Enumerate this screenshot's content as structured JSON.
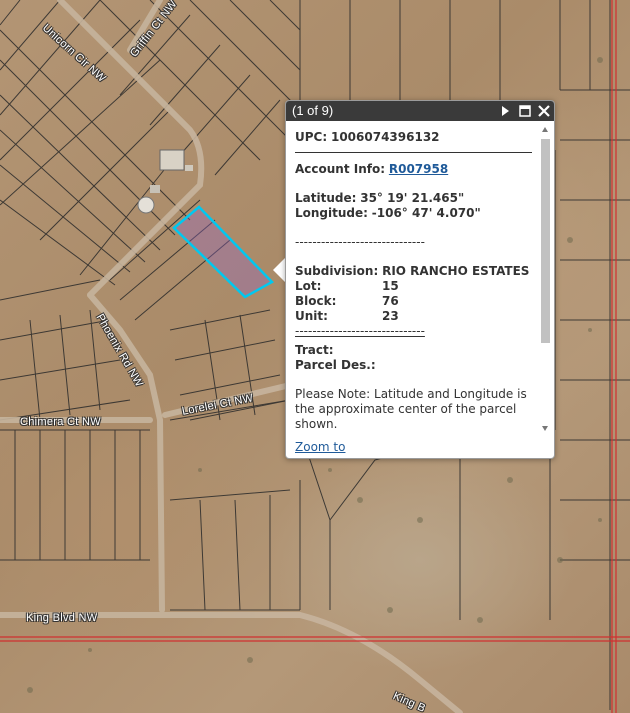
{
  "map": {
    "streets": {
      "unicorn": "Unicorn Cir NW",
      "griffin": "Griffin Ct NW",
      "phoenix": "Phoenix Rd NW",
      "lorelei": "Lorelei Ct NW",
      "chimera": "Chimera Ct NW",
      "king": "King Blvd NW",
      "king_cut": "King B"
    },
    "parcel_highlight_color": "#00c8f0",
    "boundary_line_color": "#d03030",
    "lot_line_color": "#2a2a2a"
  },
  "popup": {
    "title": "(1 of 9)",
    "upc_label": "UPC:",
    "upc_value": "1006074396132",
    "account_label": "Account Info:",
    "account_value": "R007958",
    "latitude_label": "Latitude:",
    "latitude_value": "35° 19' 21.465\"",
    "longitude_label": "Longitude:",
    "longitude_value": "-106° 47' 4.070\"",
    "separator": "------------------------------",
    "subdivision_label": "Subdivision:",
    "subdivision_value": "RIO RANCHO ESTATES",
    "lot_label": "Lot:",
    "lot_value": "15",
    "block_label": "Block:",
    "block_value": "76",
    "unit_label": "Unit:",
    "unit_value": "23",
    "tract_label": "Tract:",
    "parcel_des_label": "Parcel Des.:",
    "note": "Please Note: Latitude and Longitude is the approximate center of the parcel shown.",
    "zoom_link": "Zoom to",
    "buttons": {
      "next": "play-icon",
      "maximize": "maximize-icon",
      "close": "close-icon"
    }
  }
}
